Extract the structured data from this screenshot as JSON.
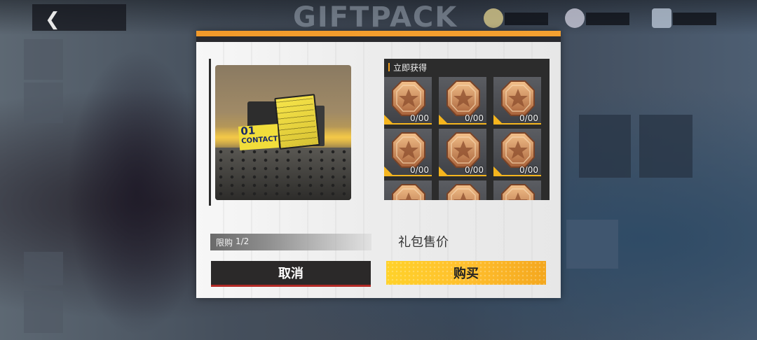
{
  "background": {
    "title": "GIFTPACK"
  },
  "dialog": {
    "rewards_title": "立即获得",
    "rewards": [
      {
        "count": "0/00"
      },
      {
        "count": "0/00"
      },
      {
        "count": "0/00"
      },
      {
        "count": "0/00"
      },
      {
        "count": "0/00"
      },
      {
        "count": "0/00"
      },
      {
        "count": ""
      },
      {
        "count": ""
      },
      {
        "count": ""
      }
    ],
    "preview": {
      "card_number": "01",
      "card_text": "CONTACT"
    },
    "limit": {
      "label": "限购",
      "value": "1/2"
    },
    "price_label": "礼包售价",
    "cancel_label": "取消",
    "buy_label": "购买"
  },
  "colors": {
    "accent_orange": "#f29a2a",
    "buy_yellow": "#ffc72a",
    "cancel_dark": "#2b2929",
    "medal_bronze": "#c98a55"
  },
  "icons": {
    "back": "chevron-left-icon",
    "reward": "bronze-medal-icon"
  }
}
